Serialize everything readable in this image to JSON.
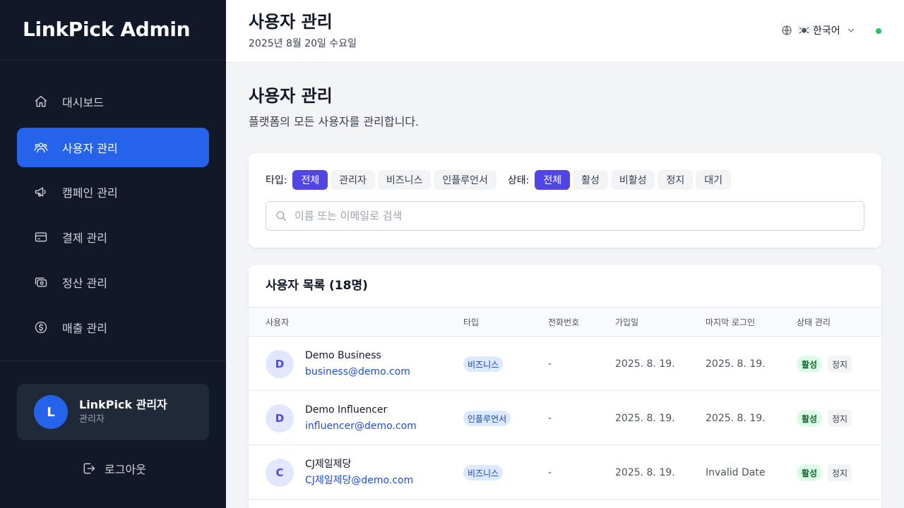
{
  "sidebar": {
    "brand": "LinkPick Admin",
    "items": [
      {
        "label": "대시보드",
        "icon": "home-icon"
      },
      {
        "label": "사용자 관리",
        "icon": "users-icon"
      },
      {
        "label": "캠페인 관리",
        "icon": "megaphone-icon"
      },
      {
        "label": "결제 관리",
        "icon": "credit-card-icon"
      },
      {
        "label": "정산 관리",
        "icon": "cash-icon"
      },
      {
        "label": "매출 관리",
        "icon": "dollar-icon"
      }
    ],
    "user": {
      "initial": "L",
      "name": "LinkPick 관리자",
      "role": "관리자"
    },
    "logout": "로그아웃"
  },
  "header": {
    "title": "사용자 관리",
    "date": "2025년 8월 20일 수요일",
    "language": "한국어"
  },
  "main": {
    "title": "사용자 관리",
    "subtitle": "플랫폼의 모든 사용자를 관리합니다.",
    "filters": {
      "type_label": "타입:",
      "type_options": [
        "전체",
        "관리자",
        "비즈니스",
        "인플루언서"
      ],
      "status_label": "상태:",
      "status_options": [
        "전체",
        "활성",
        "비활성",
        "정지",
        "대기"
      ],
      "search_placeholder": "이름 또는 이메일로 검색"
    },
    "table": {
      "title": "사용자 목록 (18명)",
      "columns": [
        "사용자",
        "타입",
        "전화번호",
        "가입일",
        "마지막 로그인",
        "상태 관리"
      ],
      "rows": [
        {
          "initial": "D",
          "name": "Demo Business",
          "email": "business@demo.com",
          "type": "비즈니스",
          "phone": "-",
          "joined": "2025. 8. 19.",
          "last_login": "2025. 8. 19.",
          "status": "활성",
          "action": "정지"
        },
        {
          "initial": "D",
          "name": "Demo Influencer",
          "email": "influencer@demo.com",
          "type": "인플루언서",
          "phone": "-",
          "joined": "2025. 8. 19.",
          "last_login": "2025. 8. 19.",
          "status": "활성",
          "action": "정지"
        },
        {
          "initial": "C",
          "name": "CJ제일제당",
          "email": "CJ제일제당@demo.com",
          "type": "비즈니스",
          "phone": "-",
          "joined": "2025. 8. 19.",
          "last_login": "Invalid Date",
          "status": "활성",
          "action": "정지"
        }
      ]
    }
  }
}
